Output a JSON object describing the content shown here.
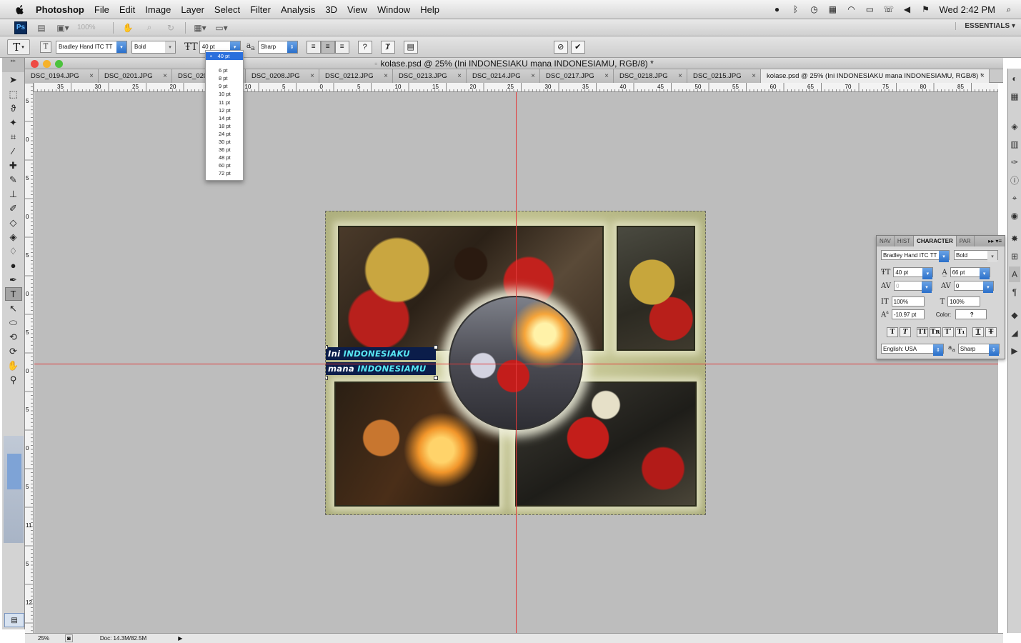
{
  "menubar": {
    "app_name": "Photoshop",
    "items": [
      "File",
      "Edit",
      "Image",
      "Layer",
      "Select",
      "Filter",
      "Analysis",
      "3D",
      "View",
      "Window",
      "Help"
    ],
    "clock": "Wed 2:42 PM"
  },
  "appbar": {
    "logo": "Ps",
    "zoom": "100%",
    "workspace": "ESSENTIALS"
  },
  "options": {
    "tool_preset": "T",
    "font_family": "Bradley Hand ITC TT",
    "font_style": "Bold",
    "font_size": "40 pt",
    "antialias_label": "a",
    "antialias": "Sharp",
    "warp_label": "?"
  },
  "size_dropdown": {
    "selected": "40 pt",
    "options": [
      "6 pt",
      "8 pt",
      "9 pt",
      "10 pt",
      "11 pt",
      "12 pt",
      "14 pt",
      "18 pt",
      "24 pt",
      "30 pt",
      "36 pt",
      "48 pt",
      "60 pt",
      "72 pt"
    ]
  },
  "document": {
    "title": "kolase.psd @ 25% (Ini INDONESIAKU mana INDONESIAMU, RGB/8) *",
    "tabs": [
      {
        "label": "DSC_0194.JPG"
      },
      {
        "label": "DSC_0201.JPG"
      },
      {
        "label": "DSC_0206.JPG"
      },
      {
        "label": "DSC_0208.JPG"
      },
      {
        "label": "DSC_0212.JPG"
      },
      {
        "label": "DSC_0213.JPG"
      },
      {
        "label": "DSC_0214.JPG"
      },
      {
        "label": "DSC_0217.JPG"
      },
      {
        "label": "DSC_0218.JPG"
      },
      {
        "label": "DSC_0215.JPG"
      },
      {
        "label": "kolase.psd @ 25% (Ini INDONESIAKU mana INDONESIAMU, RGB/8) *"
      }
    ],
    "close_glyph": "×",
    "status_zoom": "25%",
    "doc_size": "Doc: 14.3M/82.5M"
  },
  "rulers": {
    "top": [
      "35",
      "30",
      "25",
      "20",
      "15",
      "10",
      "5",
      "0",
      "5",
      "10",
      "15",
      "20",
      "25",
      "30",
      "35",
      "40",
      "45",
      "50",
      "55",
      "60",
      "65",
      "70",
      "75",
      "80",
      "85"
    ],
    "left": [
      "5",
      "0",
      "5",
      "0",
      "5",
      "0",
      "5",
      "0",
      "5",
      "0",
      "5",
      "11",
      "5",
      "12"
    ]
  },
  "collage_text": {
    "line1_a": "Ini",
    "line1_b": "INDONESIAKU",
    "line2_a": "mana",
    "line2_b": "INDONESIAMU"
  },
  "character_panel": {
    "tabs": [
      "NAV",
      "HIST",
      "CHARACTER",
      "PAR"
    ],
    "font_family": "Bradley Hand ITC TT",
    "font_style": "Bold",
    "size": "40 pt",
    "leading": "66 pt",
    "kerning": "0",
    "tracking": "0",
    "vertical_scale": "100%",
    "horizontal_scale": "100%",
    "baseline_shift": "-10.97 pt",
    "color_label": "Color:",
    "color_value": "?",
    "language": "English: USA",
    "antialias": "Sharp"
  },
  "colors": {
    "foreground": "#000000",
    "background": "#e05a1c",
    "guide": "#e23a3a",
    "selection": "#2a6fdc"
  }
}
